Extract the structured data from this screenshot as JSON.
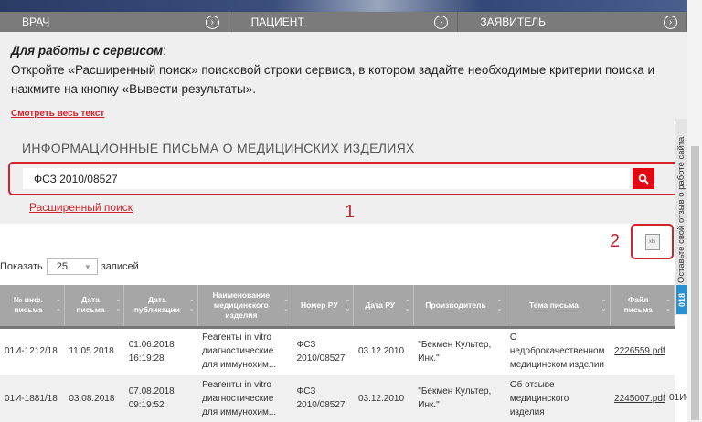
{
  "nav": [
    {
      "label": "ВРАЧ"
    },
    {
      "label": "ПАЦИЕНТ"
    },
    {
      "label": "ЗАЯВИТЕЛЬ"
    }
  ],
  "intro": {
    "heading": "Для работы с сервисом",
    "colon": ":",
    "text": "Откройте «Расширенный поиск» поисковой строки сервиса, в котором задайте необходимые критерии поиска и нажмите на кнопку «Вывести результаты».",
    "more": "Смотреть весь текст"
  },
  "search": {
    "title": "ИНФОРМАЦИОННЫЕ ПИСЬМА О МЕДИЦИНСКИХ ИЗДЕЛИЯХ",
    "value": "ФСЗ 2010/08527",
    "advanced": "Расширенный поиск"
  },
  "annotations": {
    "one": "1",
    "two": "2"
  },
  "export": {
    "label": "xls"
  },
  "length": {
    "show": "Показать",
    "value": "25",
    "records": "записей"
  },
  "table": {
    "headers": [
      "№ инф. письма",
      "Дата письма",
      "Дата публикации",
      "Наименование медицинского изделия",
      "Номер РУ",
      "Дата РУ",
      "Производитель",
      "Тема письма",
      "Файл письма"
    ],
    "rows": [
      [
        "01И-1212/18",
        "11.05.2018",
        "01.06.2018 16:19:28",
        "Реагенты in vitro диагностические для иммунохим...",
        "ФСЗ 2010/08527",
        "03.12.2010",
        "\"Бекмен Культер, Инк.\"",
        "О недоброкачественном медицинском изделии",
        "2226559.pdf"
      ],
      [
        "01И-1881/18",
        "03.08.2018",
        "07.08.2018 09:19:52",
        "Реагенты in vitro диагностические для иммунохим...",
        "ФСЗ 2010/08527",
        "03.12.2010",
        "\"Бекмен Культер, Инк.\"",
        "Об отзыве медицинского изделия",
        "2245007.pdf"
      ]
    ],
    "overflow_text": "01И-"
  },
  "feedback": {
    "text": "Оставьте свой отзыв о работе сайта",
    "badge": "018"
  }
}
